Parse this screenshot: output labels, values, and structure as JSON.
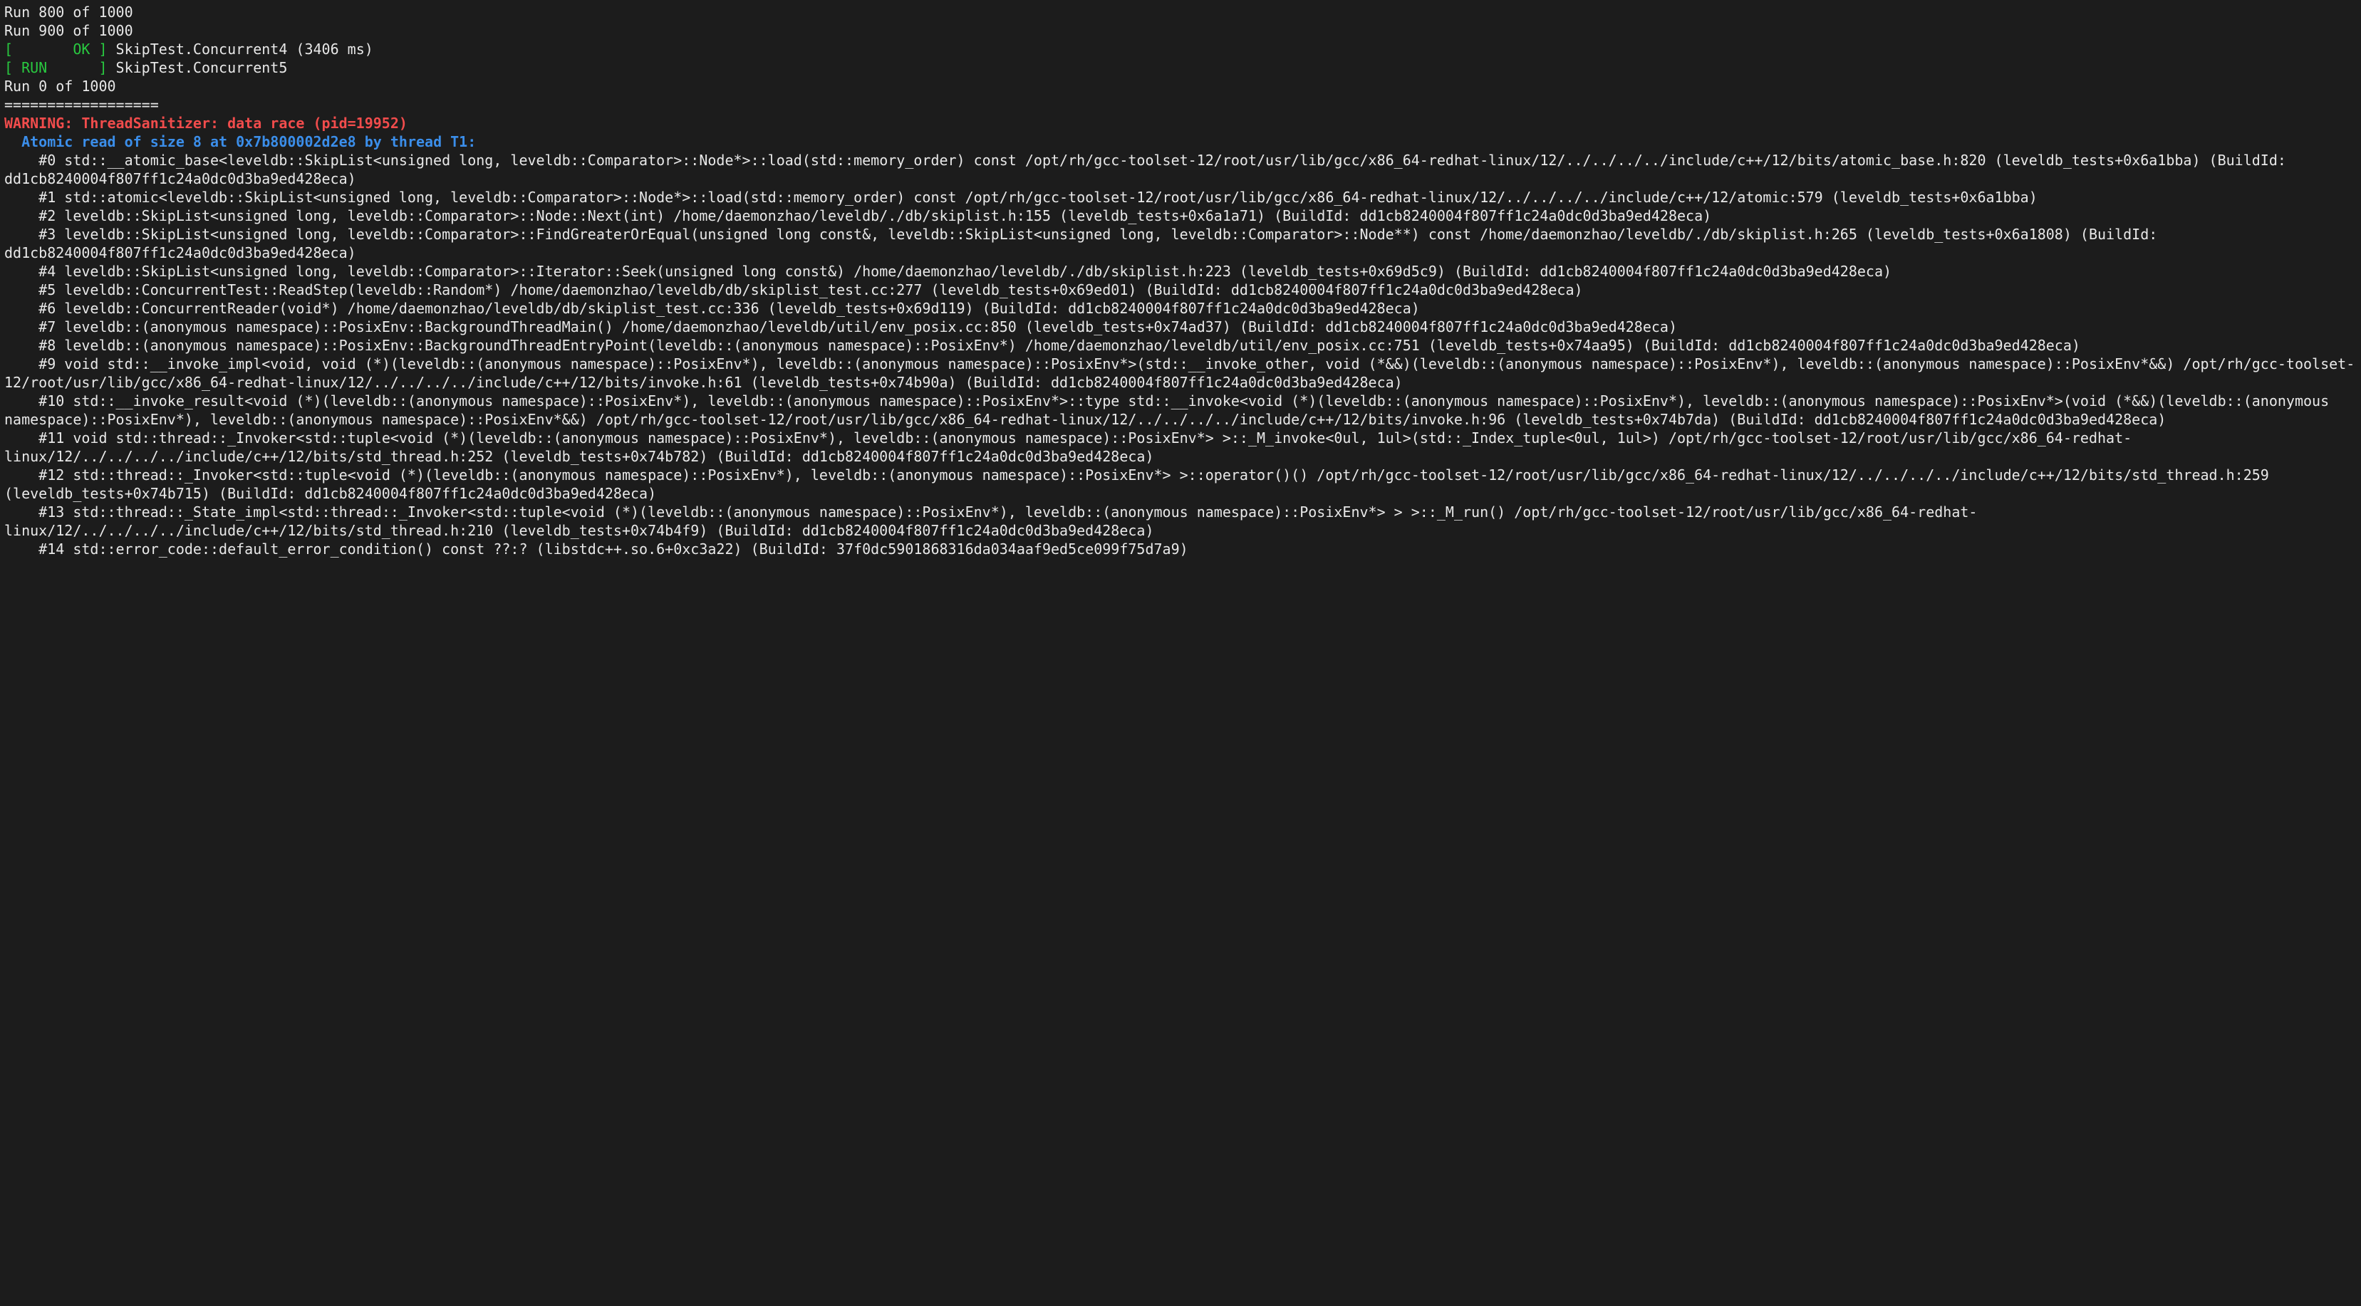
{
  "header": {
    "run_lines": [
      "Run 800 of 1000",
      "Run 900 of 1000"
    ],
    "ok_bracket_open": "[       ",
    "ok_text": "OK",
    "ok_bracket_close": " ] ",
    "ok_test": "SkipTest.Concurrent4 (3406 ms)",
    "run_bracket_open": "[ ",
    "run_text": "RUN",
    "run_bracket_close": "      ] ",
    "run_test": "SkipTest.Concurrent5",
    "post_run_line": "Run 0 of 1000",
    "separator": "=================="
  },
  "warning": {
    "text": "WARNING: ThreadSanitizer: data race (pid=19952)"
  },
  "atomic_read": {
    "text": "  Atomic read of size 8 at 0x7b800002d2e8 by thread T1:"
  },
  "frames": [
    "    #0 std::__atomic_base<leveldb::SkipList<unsigned long, leveldb::Comparator>::Node*>::load(std::memory_order) const /opt/rh/gcc-toolset-12/root/usr/lib/gcc/x86_64-redhat-linux/12/../../../../include/c++/12/bits/atomic_base.h:820 (leveldb_tests+0x6a1bba) (BuildId: dd1cb8240004f807ff1c24a0dc0d3ba9ed428eca)",
    "    #1 std::atomic<leveldb::SkipList<unsigned long, leveldb::Comparator>::Node*>::load(std::memory_order) const /opt/rh/gcc-toolset-12/root/usr/lib/gcc/x86_64-redhat-linux/12/../../../../include/c++/12/atomic:579 (leveldb_tests+0x6a1bba)",
    "    #2 leveldb::SkipList<unsigned long, leveldb::Comparator>::Node::Next(int) /home/daemonzhao/leveldb/./db/skiplist.h:155 (leveldb_tests+0x6a1a71) (BuildId: dd1cb8240004f807ff1c24a0dc0d3ba9ed428eca)",
    "    #3 leveldb::SkipList<unsigned long, leveldb::Comparator>::FindGreaterOrEqual(unsigned long const&, leveldb::SkipList<unsigned long, leveldb::Comparator>::Node**) const /home/daemonzhao/leveldb/./db/skiplist.h:265 (leveldb_tests+0x6a1808) (BuildId: dd1cb8240004f807ff1c24a0dc0d3ba9ed428eca)",
    "    #4 leveldb::SkipList<unsigned long, leveldb::Comparator>::Iterator::Seek(unsigned long const&) /home/daemonzhao/leveldb/./db/skiplist.h:223 (leveldb_tests+0x69d5c9) (BuildId: dd1cb8240004f807ff1c24a0dc0d3ba9ed428eca)",
    "    #5 leveldb::ConcurrentTest::ReadStep(leveldb::Random*) /home/daemonzhao/leveldb/db/skiplist_test.cc:277 (leveldb_tests+0x69ed01) (BuildId: dd1cb8240004f807ff1c24a0dc0d3ba9ed428eca)",
    "    #6 leveldb::ConcurrentReader(void*) /home/daemonzhao/leveldb/db/skiplist_test.cc:336 (leveldb_tests+0x69d119) (BuildId: dd1cb8240004f807ff1c24a0dc0d3ba9ed428eca)",
    "    #7 leveldb::(anonymous namespace)::PosixEnv::BackgroundThreadMain() /home/daemonzhao/leveldb/util/env_posix.cc:850 (leveldb_tests+0x74ad37) (BuildId: dd1cb8240004f807ff1c24a0dc0d3ba9ed428eca)",
    "    #8 leveldb::(anonymous namespace)::PosixEnv::BackgroundThreadEntryPoint(leveldb::(anonymous namespace)::PosixEnv*) /home/daemonzhao/leveldb/util/env_posix.cc:751 (leveldb_tests+0x74aa95) (BuildId: dd1cb8240004f807ff1c24a0dc0d3ba9ed428eca)",
    "    #9 void std::__invoke_impl<void, void (*)(leveldb::(anonymous namespace)::PosixEnv*), leveldb::(anonymous namespace)::PosixEnv*>(std::__invoke_other, void (*&&)(leveldb::(anonymous namespace)::PosixEnv*), leveldb::(anonymous namespace)::PosixEnv*&&) /opt/rh/gcc-toolset-12/root/usr/lib/gcc/x86_64-redhat-linux/12/../../../../include/c++/12/bits/invoke.h:61 (leveldb_tests+0x74b90a) (BuildId: dd1cb8240004f807ff1c24a0dc0d3ba9ed428eca)",
    "    #10 std::__invoke_result<void (*)(leveldb::(anonymous namespace)::PosixEnv*), leveldb::(anonymous namespace)::PosixEnv*>::type std::__invoke<void (*)(leveldb::(anonymous namespace)::PosixEnv*), leveldb::(anonymous namespace)::PosixEnv*>(void (*&&)(leveldb::(anonymous namespace)::PosixEnv*), leveldb::(anonymous namespace)::PosixEnv*&&) /opt/rh/gcc-toolset-12/root/usr/lib/gcc/x86_64-redhat-linux/12/../../../../include/c++/12/bits/invoke.h:96 (leveldb_tests+0x74b7da) (BuildId: dd1cb8240004f807ff1c24a0dc0d3ba9ed428eca)",
    "    #11 void std::thread::_Invoker<std::tuple<void (*)(leveldb::(anonymous namespace)::PosixEnv*), leveldb::(anonymous namespace)::PosixEnv*> >::_M_invoke<0ul, 1ul>(std::_Index_tuple<0ul, 1ul>) /opt/rh/gcc-toolset-12/root/usr/lib/gcc/x86_64-redhat-linux/12/../../../../include/c++/12/bits/std_thread.h:252 (leveldb_tests+0x74b782) (BuildId: dd1cb8240004f807ff1c24a0dc0d3ba9ed428eca)",
    "    #12 std::thread::_Invoker<std::tuple<void (*)(leveldb::(anonymous namespace)::PosixEnv*), leveldb::(anonymous namespace)::PosixEnv*> >::operator()() /opt/rh/gcc-toolset-12/root/usr/lib/gcc/x86_64-redhat-linux/12/../../../../include/c++/12/bits/std_thread.h:259 (leveldb_tests+0x74b715) (BuildId: dd1cb8240004f807ff1c24a0dc0d3ba9ed428eca)",
    "    #13 std::thread::_State_impl<std::thread::_Invoker<std::tuple<void (*)(leveldb::(anonymous namespace)::PosixEnv*), leveldb::(anonymous namespace)::PosixEnv*> > >::_M_run() /opt/rh/gcc-toolset-12/root/usr/lib/gcc/x86_64-redhat-linux/12/../../../../include/c++/12/bits/std_thread.h:210 (leveldb_tests+0x74b4f9) (BuildId: dd1cb8240004f807ff1c24a0dc0d3ba9ed428eca)",
    "    #14 std::error_code::default_error_condition() const ??:? (libstdc++.so.6+0xc3a22) (BuildId: 37f0dc5901868316da034aaf9ed5ce099f75d7a9)"
  ]
}
